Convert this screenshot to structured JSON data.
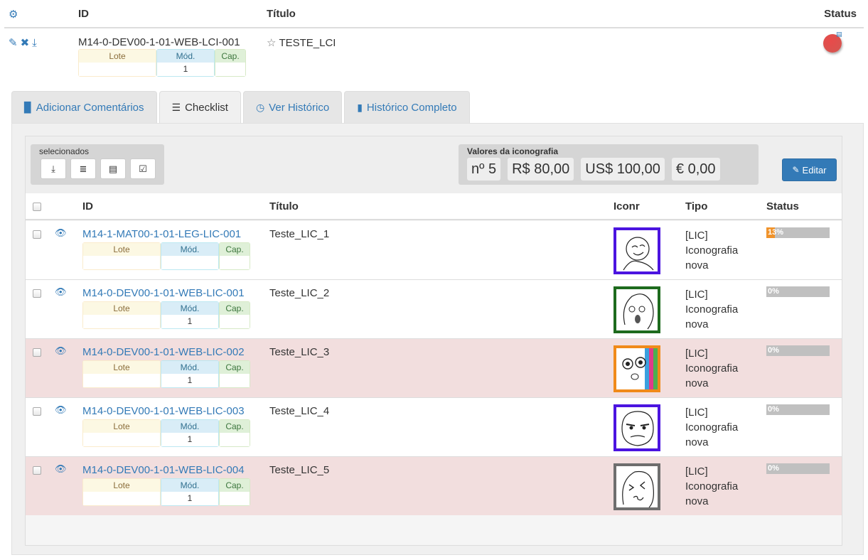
{
  "header": {
    "id_label": "ID",
    "title_label": "Título",
    "status_label": "Status"
  },
  "item": {
    "id": "M14-0-DEV00-1-01-WEB-LCI-001",
    "title": "TESTE_LCI",
    "lote_label": "Lote",
    "mod_label": "Mód.",
    "cap_label": "Cap.",
    "lote_value": "",
    "mod_value": "1",
    "cap_value": "",
    "status_color": "#d9534f"
  },
  "tabs": [
    {
      "label": "Adicionar Comentários",
      "icon": "file-icon"
    },
    {
      "label": "Checklist",
      "icon": "list-icon"
    },
    {
      "label": "Ver Histórico",
      "icon": "clock-icon"
    },
    {
      "label": "Histórico Completo",
      "icon": "book-icon"
    }
  ],
  "toolbar": {
    "selected_title": "selecionados",
    "iconography_title": "Valores da iconografia",
    "count": "nº 5",
    "brl": "R$ 80,00",
    "usd": "US$ 100,00",
    "eur": "€ 0,00",
    "edit_label": "Editar"
  },
  "table": {
    "columns": {
      "id": "ID",
      "title": "Título",
      "icon": "Iconr",
      "type": "Tipo",
      "status": "Status"
    },
    "rows": [
      {
        "id": "M14-1-MAT00-1-01-LEG-LIC-001",
        "title": "Teste_LIC_1",
        "type_line1": "[LIC]",
        "type_line2": "Iconografia",
        "type_line3": "nova",
        "progress": "13%",
        "progress_value": 13,
        "lote_label": "Lote",
        "mod_label": "Mód.",
        "cap_label": "Cap.",
        "mod_value": "",
        "border_color": "#4b14e0",
        "highlight": false
      },
      {
        "id": "M14-0-DEV00-1-01-WEB-LIC-001",
        "title": "Teste_LIC_2",
        "type_line1": "[LIC]",
        "type_line2": "Iconografia",
        "type_line3": "nova",
        "progress": "0%",
        "progress_value": 0,
        "lote_label": "Lote",
        "mod_label": "Mód.",
        "cap_label": "Cap.",
        "mod_value": "1",
        "border_color": "#1e6b1e",
        "highlight": false
      },
      {
        "id": "M14-0-DEV00-1-01-WEB-LIC-002",
        "title": "Teste_LIC_3",
        "type_line1": "[LIC]",
        "type_line2": "Iconografia",
        "type_line3": "nova",
        "progress": "0%",
        "progress_value": 0,
        "lote_label": "Lote",
        "mod_label": "Mód.",
        "cap_label": "Cap.",
        "mod_value": "1",
        "border_color": "#f08a1a",
        "highlight": true
      },
      {
        "id": "M14-0-DEV00-1-01-WEB-LIC-003",
        "title": "Teste_LIC_4",
        "type_line1": "[LIC]",
        "type_line2": "Iconografia",
        "type_line3": "nova",
        "progress": "0%",
        "progress_value": 0,
        "lote_label": "Lote",
        "mod_label": "Mód.",
        "cap_label": "Cap.",
        "mod_value": "1",
        "border_color": "#4b14e0",
        "highlight": false
      },
      {
        "id": "M14-0-DEV00-1-01-WEB-LIC-004",
        "title": "Teste_LIC_5",
        "type_line1": "[LIC]",
        "type_line2": "Iconografia",
        "type_line3": "nova",
        "progress": "0%",
        "progress_value": 0,
        "lote_label": "Lote",
        "mod_label": "Mód.",
        "cap_label": "Cap.",
        "mod_value": "1",
        "border_color": "#6e6e6e",
        "highlight": true
      }
    ]
  }
}
